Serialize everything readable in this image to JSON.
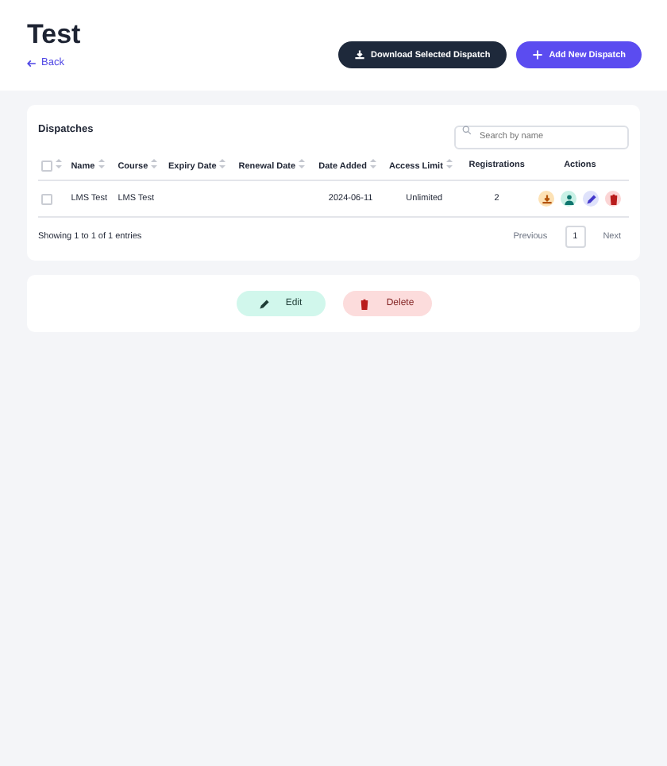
{
  "header": {
    "title": "Test",
    "back_link": "Back",
    "buttons": [
      {
        "kind": "download",
        "label": "Download Selected Dispatch"
      },
      {
        "kind": "add",
        "label": "Add New Dispatch"
      }
    ]
  },
  "dispatches": {
    "title": "Dispatches",
    "search": {
      "placeholder": "Search by name"
    },
    "select_all": {
      "checked": false,
      "sortable": true
    },
    "columns": [
      {
        "label": "Name",
        "sortable": true
      },
      {
        "label": "Course",
        "sortable": true
      },
      {
        "label": "Expiry Date",
        "sortable": true
      },
      {
        "label": "Renewal Date",
        "sortable": true
      },
      {
        "label": "Date Added",
        "sortable": true
      },
      {
        "label": "Access Limit",
        "sortable": true
      },
      {
        "label": "Registrations",
        "sortable": false
      },
      {
        "label": "Actions",
        "sortable": false
      }
    ],
    "rows": [
      {
        "checked": false,
        "cells": [
          "LMS Test",
          "LMS Test",
          "",
          "",
          "2024-06-11",
          "Unlimited",
          "2"
        ],
        "actions": [
          {
            "kind": "download",
            "color": "#fde2b5"
          },
          {
            "kind": "user",
            "color": "#c9f1e6"
          },
          {
            "kind": "edit",
            "color": "#dfe2fb"
          },
          {
            "kind": "delete",
            "color": "#fbd5d5"
          }
        ]
      }
    ],
    "info": "Showing 1 to 1 of 1 entries",
    "pagination": [
      {
        "label": "Previous",
        "selected": false
      },
      {
        "label": "1",
        "selected": true
      },
      {
        "label": "Next",
        "selected": false
      }
    ]
  },
  "actions_card": {
    "buttons": [
      {
        "kind": "edit",
        "label": "Edit"
      },
      {
        "kind": "delete",
        "label": "Delete"
      }
    ]
  }
}
